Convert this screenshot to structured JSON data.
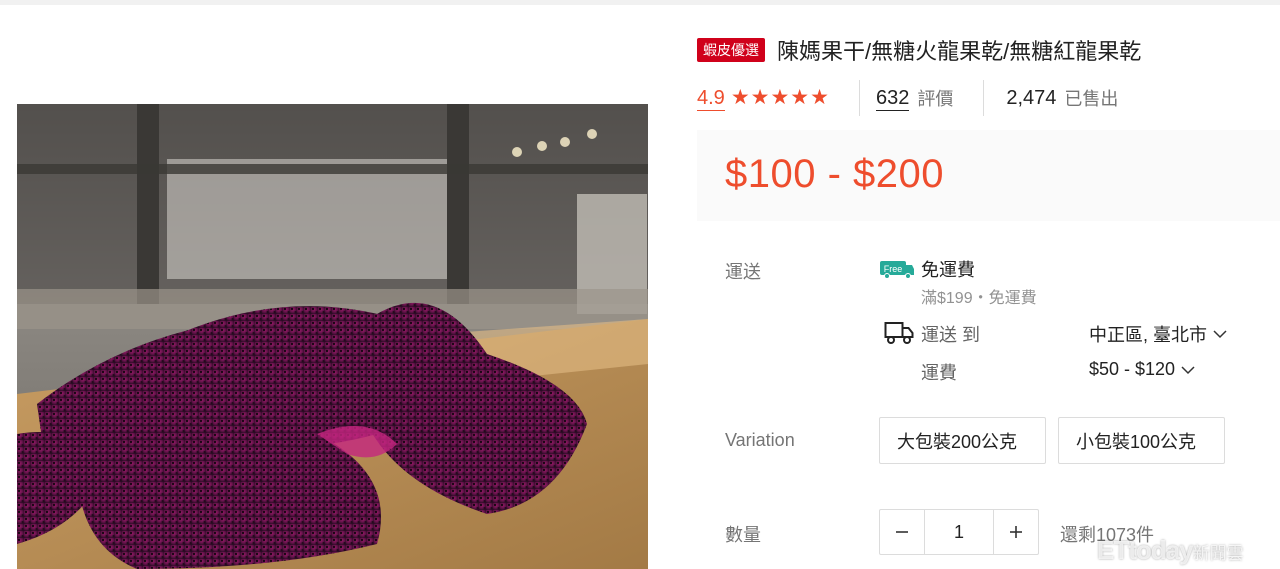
{
  "product": {
    "badge": "蝦皮優選",
    "title": "陳媽果干/無糖火龍果乾/無糖紅龍果乾",
    "rating": "4.9",
    "reviews_count": "632",
    "reviews_label": "評價",
    "sold_count": "2,474",
    "sold_label": "已售出",
    "price": "$100 - $200"
  },
  "shipping": {
    "label": "運送",
    "free_badge": "Free",
    "free_title": "免運費",
    "free_condition": "滿$199・免運費",
    "ship_to_label": "運送 到",
    "ship_to_value": "中正區, 臺北市",
    "fee_label": "運費",
    "fee_value": "$50 - $120"
  },
  "variation": {
    "label": "Variation",
    "options": [
      "大包裝200公克",
      "小包裝100公克"
    ]
  },
  "quantity": {
    "label": "數量",
    "value": "1",
    "stock": "還剩1073件"
  },
  "watermark": {
    "brand": "ETtoday",
    "suffix": "新聞雲"
  },
  "colors": {
    "accent": "#ee4d2d",
    "badge_bg": "#d0011b",
    "free_green": "#26aa99",
    "price_bg": "#fafafa"
  }
}
